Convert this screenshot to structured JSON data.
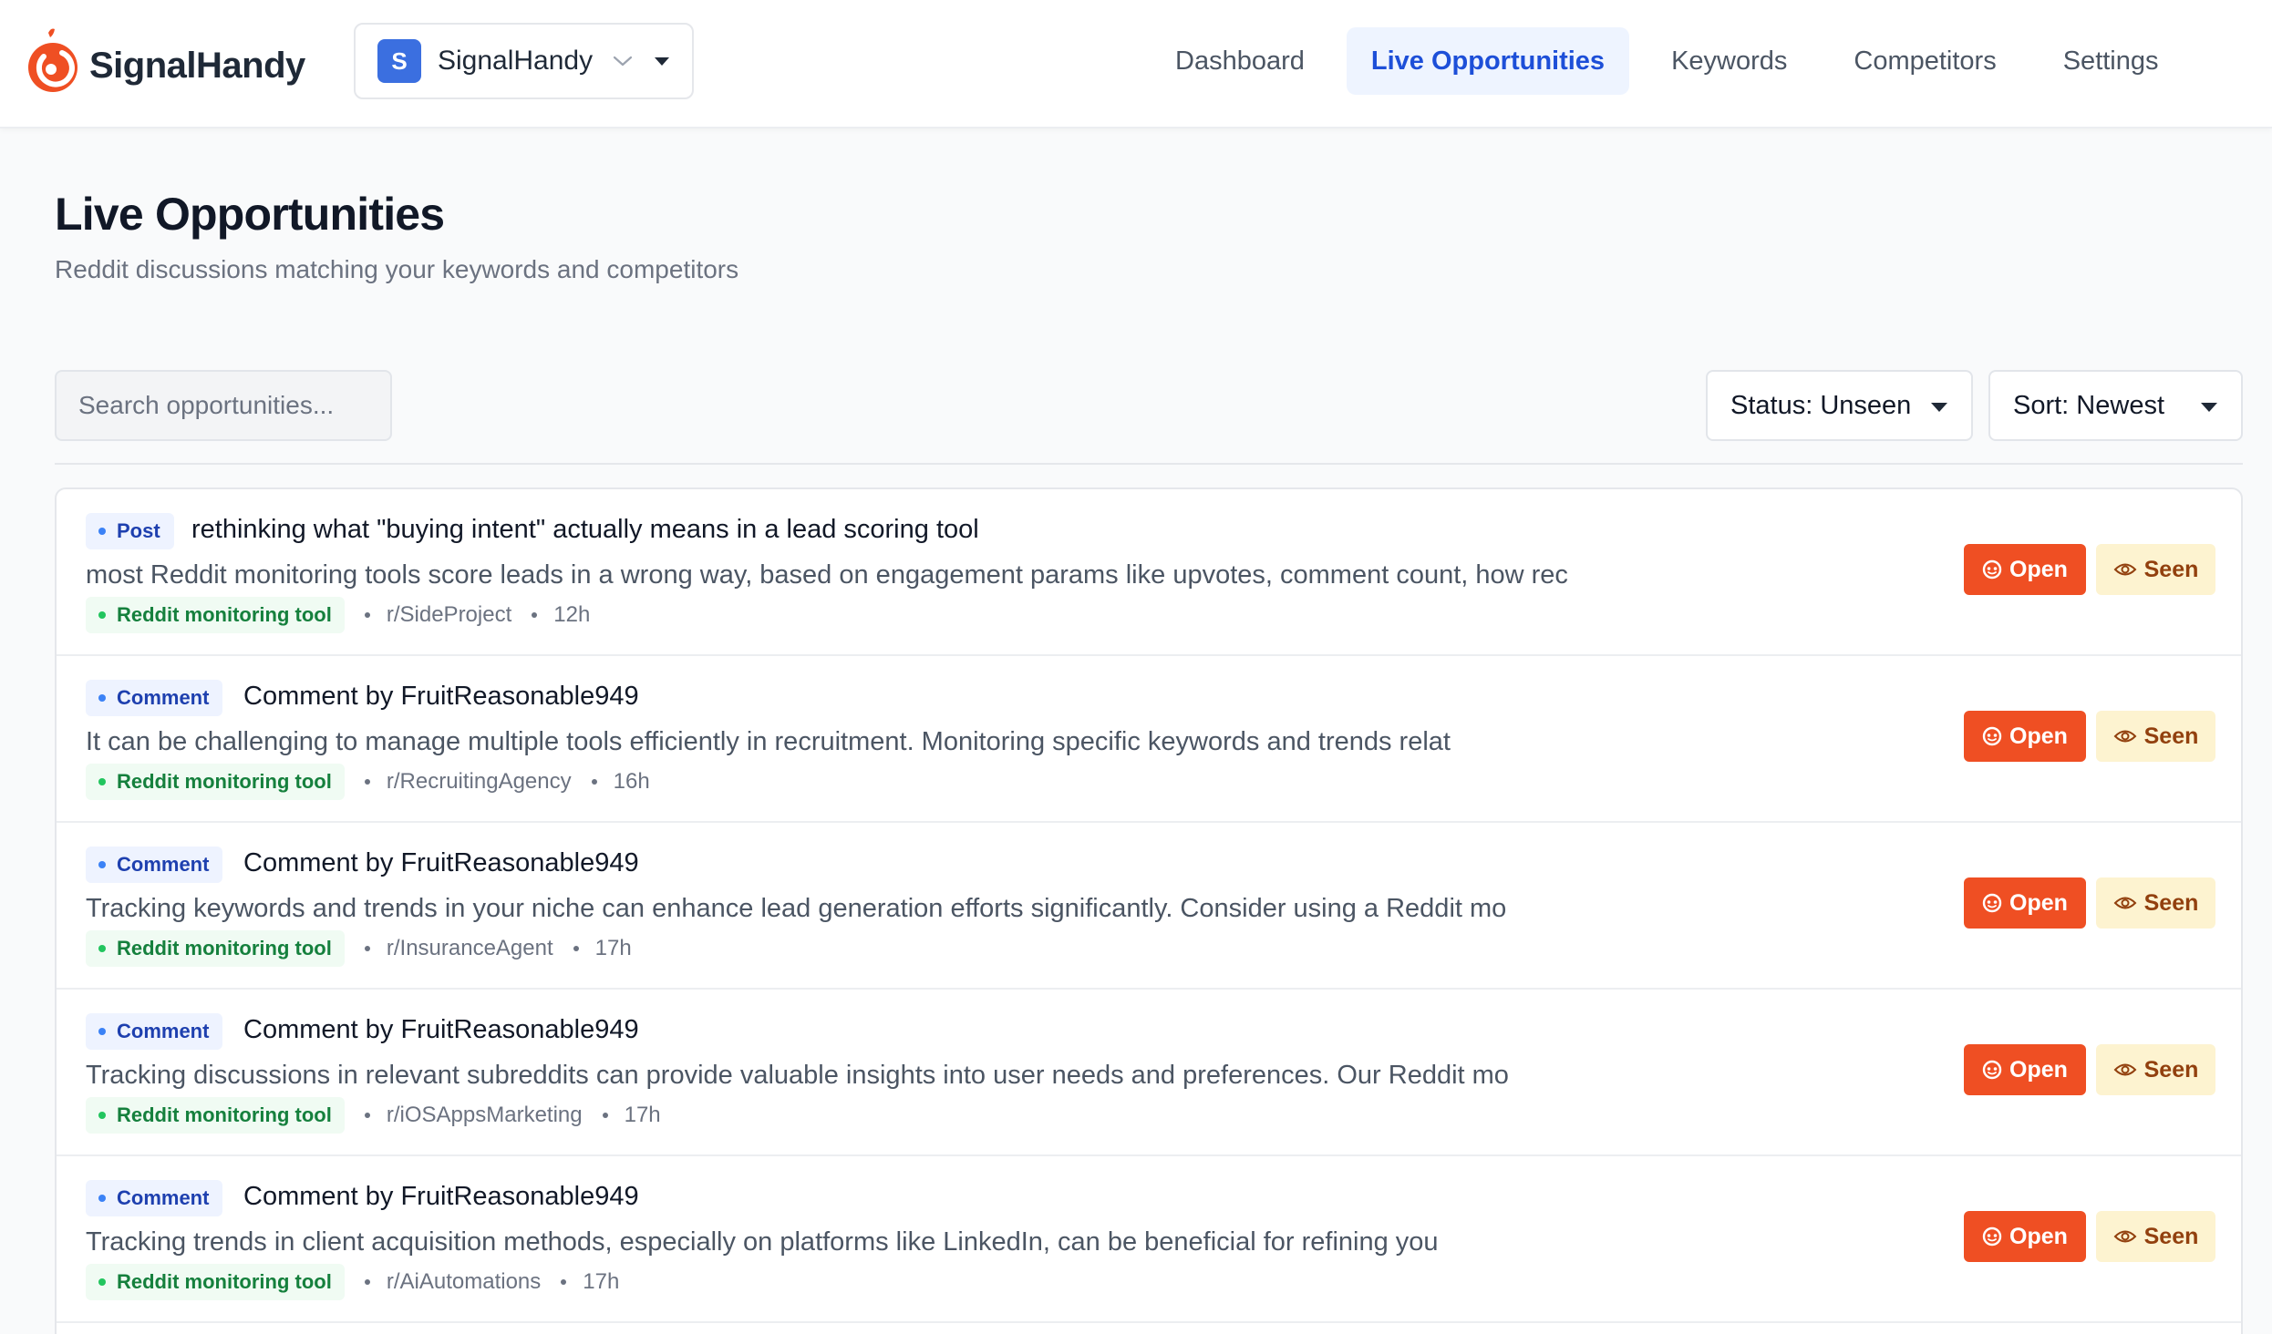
{
  "app": {
    "name": "SignalHandy",
    "org_initial": "S",
    "org_name": "SignalHandy"
  },
  "colors": {
    "brand": "#ef4f23",
    "nav_active_bg": "#eef4ff",
    "nav_active_text": "#1d4fd8",
    "post_badge": "#1e40af",
    "keyword_badge": "#15803d",
    "seen_bg": "#fdf3d0"
  },
  "nav": {
    "dashboard": "Dashboard",
    "live_opportunities": "Live Opportunities",
    "keywords": "Keywords",
    "competitors": "Competitors",
    "settings": "Settings",
    "active": "live_opportunities"
  },
  "page": {
    "title": "Live Opportunities",
    "subtitle": "Reddit discussions matching your keywords and competitors"
  },
  "toolbar": {
    "search_placeholder": "Search opportunities...",
    "search_value": "",
    "status_select": "Status: Unseen",
    "sort_select": "Sort: Newest"
  },
  "actions": {
    "open_label": "Open",
    "seen_label": "Seen",
    "open_icon": "reddit-icon",
    "seen_icon": "eye-icon"
  },
  "items": [
    {
      "type": "Post",
      "title": "rethinking what \"buying intent\" actually means in a lead scoring tool",
      "excerpt": "most Reddit monitoring tools score leads in a wrong way, based on engagement params like upvotes, comment count, how rec",
      "keyword": "Reddit monitoring tool",
      "subreddit": "r/SideProject",
      "age": "12h"
    },
    {
      "type": "Comment",
      "title": "Comment by FruitReasonable949",
      "excerpt": "It can be challenging to manage multiple tools efficiently in recruitment. Monitoring specific keywords and trends relat",
      "keyword": "Reddit monitoring tool",
      "subreddit": "r/RecruitingAgency",
      "age": "16h"
    },
    {
      "type": "Comment",
      "title": "Comment by FruitReasonable949",
      "excerpt": "Tracking keywords and trends in your niche can enhance lead generation efforts significantly. Consider using a Reddit mo",
      "keyword": "Reddit monitoring tool",
      "subreddit": "r/InsuranceAgent",
      "age": "17h"
    },
    {
      "type": "Comment",
      "title": "Comment by FruitReasonable949",
      "excerpt": "Tracking discussions in relevant subreddits can provide valuable insights into user needs and preferences. Our Reddit mo",
      "keyword": "Reddit monitoring tool",
      "subreddit": "r/iOSAppsMarketing",
      "age": "17h"
    },
    {
      "type": "Comment",
      "title": "Comment by FruitReasonable949",
      "excerpt": "Tracking trends in client acquisition methods, especially on platforms like LinkedIn, can be beneficial for refining you",
      "keyword": "Reddit monitoring tool",
      "subreddit": "r/AiAutomations",
      "age": "17h"
    }
  ]
}
